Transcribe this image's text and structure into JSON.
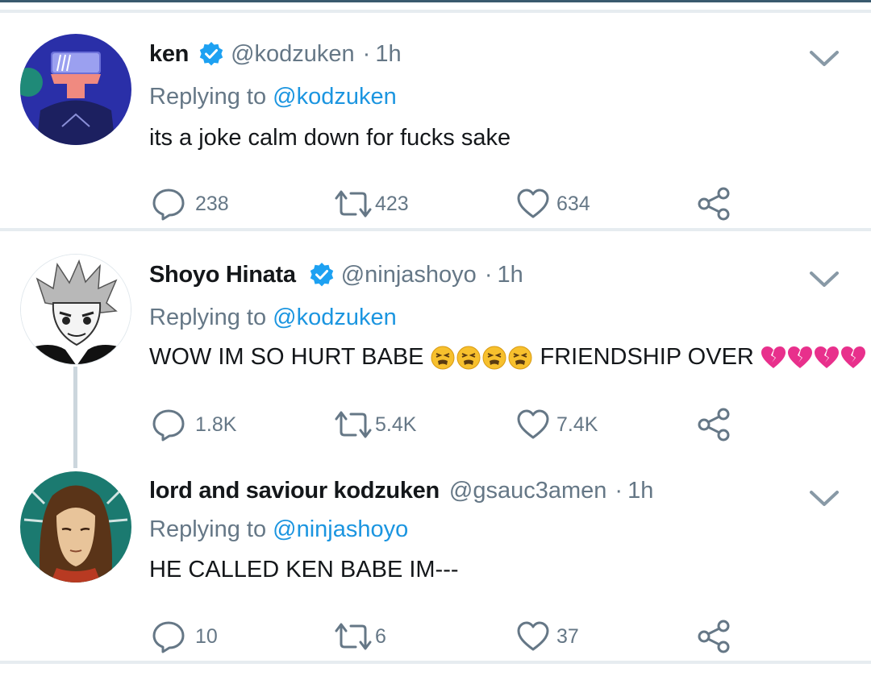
{
  "tweets": [
    {
      "name": "ken",
      "verified": true,
      "handle": "@kodzuken",
      "time": "1h",
      "replying_prefix": "Replying to",
      "replying_to": "@kodzuken",
      "text": "its a joke calm down for fucks sake",
      "replies": "238",
      "retweets": "423",
      "likes": "634"
    },
    {
      "name": "Shoyo Hinata",
      "verified": true,
      "handle": "@ninjashoyo",
      "time": "1h",
      "replying_prefix": "Replying to",
      "replying_to": "@kodzuken",
      "text_part1": "WOW IM SO HURT BABE",
      "text_part2": "FRIENDSHIP OVER",
      "emojis_1": [
        "tired-face-emoji",
        "tired-face-emoji",
        "tired-face-emoji",
        "tired-face-emoji"
      ],
      "emojis_2": [
        "broken-heart-emoji",
        "broken-heart-emoji",
        "broken-heart-emoji",
        "broken-heart-emoji"
      ],
      "replies": "1.8K",
      "retweets": "5.4K",
      "likes": "7.4K"
    },
    {
      "name": "lord and saviour kodzuken",
      "verified": false,
      "handle": "@gsauc3amen",
      "time": "1h",
      "replying_prefix": "Replying to",
      "replying_to": "@ninjashoyo",
      "text": "HE CALLED KEN BABE IM---",
      "replies": "10",
      "retweets": "6",
      "likes": "37"
    }
  ],
  "colors": {
    "link": "#1b95e0",
    "secondary": "#657786",
    "verified": "#1da1f2",
    "divider": "#e6ecf0",
    "broken_heart": "#e8308c"
  }
}
